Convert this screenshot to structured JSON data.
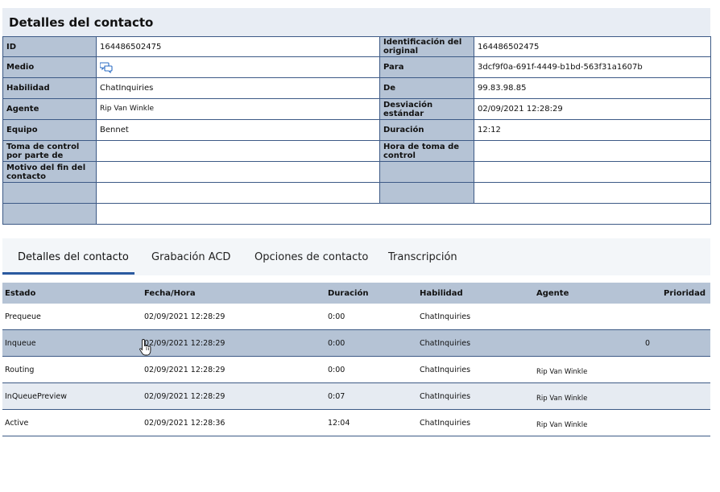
{
  "header": {
    "title": "Detalles del contacto"
  },
  "details": [
    {
      "l1": "ID",
      "v1": "164486502475",
      "l2": "Identificación del original",
      "v2": "164486502475"
    },
    {
      "l1": "Medio",
      "v1": "",
      "icon": "chat-bubbles-icon",
      "l2": "Para",
      "v2": "3dcf9f0a-691f-4449-b1bd-563f31a1607b"
    },
    {
      "l1": "Habilidad",
      "v1": "ChatInquiries",
      "l2": "De",
      "v2": "99.83.98.85"
    },
    {
      "l1": "Agente",
      "v1": "Rip Van Winkle",
      "l2": "Desviación estándar",
      "v2": "02/09/2021 12:28:29"
    },
    {
      "l1": "Equipo",
      "v1": "Bennet",
      "l2": "Duración",
      "v2": "12:12"
    },
    {
      "l1": "Toma de control por parte de",
      "v1": "",
      "l2": "Hora de toma de control",
      "v2": ""
    },
    {
      "l1": "Motivo del fin del contacto",
      "v1": "",
      "l2": "",
      "v2": ""
    },
    {
      "l1": "",
      "v1": "",
      "l2": "",
      "v2": ""
    },
    {
      "l1": "",
      "v1": ""
    }
  ],
  "tabs": [
    {
      "label": "Detalles del contacto",
      "active": true
    },
    {
      "label": "Grabación ACD"
    },
    {
      "label": "Opciones de contacto"
    },
    {
      "label": "Transcripción"
    }
  ],
  "history": {
    "columns": [
      "Estado",
      "Fecha/Hora",
      "Duración",
      "Habilidad",
      "Agente",
      "Prioridad"
    ],
    "rows": [
      [
        "Prequeue",
        "02/09/2021 12:28:29",
        "0:00",
        "ChatInquiries",
        "",
        ""
      ],
      [
        "Inqueue",
        "02/09/2021 12:28:29",
        "0:00",
        "ChatInquiries",
        "",
        "0"
      ],
      [
        "Routing",
        "02/09/2021 12:28:29",
        "0:00",
        "ChatInquiries",
        "Rip Van Winkle",
        ""
      ],
      [
        "InQueuePreview",
        "02/09/2021 12:28:29",
        "0:07",
        "ChatInquiries",
        "Rip Van Winkle",
        ""
      ],
      [
        "Active",
        "02/09/2021 12:28:36",
        "12:04",
        "ChatInquiries",
        "Rip Van Winkle",
        ""
      ]
    ]
  },
  "colors": {
    "label_bg": "#b5c3d5",
    "border": "#3d5a86",
    "accent": "#2b5aa0",
    "header_bg": "#e8edf4"
  }
}
